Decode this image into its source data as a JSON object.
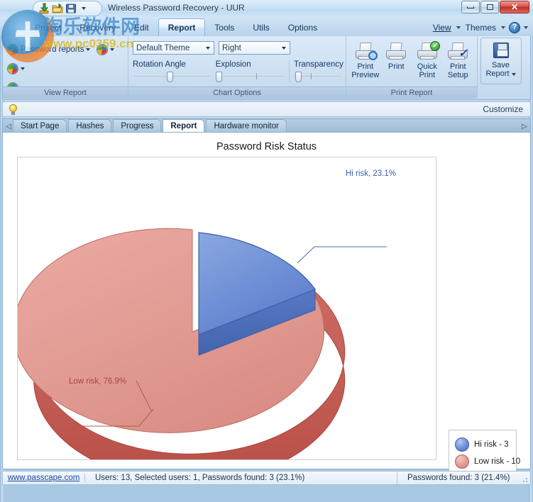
{
  "window": {
    "title": "Wireless Password Recovery - UUR",
    "quick_access": [
      "download-icon",
      "open-folder-icon",
      "save-icon",
      "qat-dropdown-icon"
    ],
    "controls": {
      "minimize": "minimize-icon",
      "maximize": "maximize-icon",
      "close": "✕"
    }
  },
  "menu": {
    "items": [
      "Project",
      "Recovery",
      "Edit",
      "Report",
      "Tools",
      "Utils",
      "Options"
    ],
    "active": "Report",
    "right": {
      "view": "View",
      "themes": "Themes",
      "help": "?"
    }
  },
  "ribbon": {
    "groups": [
      {
        "title": "View Report",
        "rows": [
          {
            "label": "Password reports",
            "icon": "pie-report-icon"
          },
          {
            "label": "",
            "icon": "pie-report-icon"
          },
          {
            "label": "",
            "icon": "pie-report-icon"
          }
        ]
      },
      {
        "title": "Chart Options",
        "theme_combo": "Default Theme",
        "legend_combo": "Right",
        "rotation_label": "Rotation Angle",
        "explosion_label": "Explosion",
        "transparency_label": "Transparency"
      },
      {
        "title": "Print Report",
        "buttons": [
          {
            "line1": "Print",
            "line2": "Preview",
            "icon": "print-preview-icon"
          },
          {
            "line1": "Print",
            "line2": "",
            "icon": "print-icon"
          },
          {
            "line1": "Quick",
            "line2": "Print",
            "icon": "quick-print-icon"
          },
          {
            "line1": "Print",
            "line2": "Setup",
            "icon": "print-setup-icon"
          }
        ]
      },
      {
        "title": "",
        "save": {
          "line1": "Save",
          "line2": "Report",
          "icon": "save-report-icon"
        }
      }
    ]
  },
  "customize_bar": {
    "hint_icon": "lightbulb-icon",
    "label": "Customize"
  },
  "tabs": {
    "items": [
      "Start Page",
      "Hashes",
      "Progress",
      "Report",
      "Hardware monitor"
    ],
    "selected": "Report",
    "scroll_left": "◁",
    "scroll_right": "▷"
  },
  "chart_data": {
    "type": "pie",
    "title": "Password Risk Status",
    "categories": [
      "Hi risk",
      "Low risk"
    ],
    "values": [
      3,
      10
    ],
    "percent_labels": [
      "Hi risk, 23.1%",
      "Low risk, 76.9%"
    ],
    "percents": [
      23.1,
      76.9
    ],
    "colors": [
      "#6B8FD4",
      "#DD8A80"
    ],
    "legend": {
      "position": "right",
      "entries": [
        "Hi risk - 3",
        "Low risk - 10"
      ]
    },
    "three_d": true,
    "start_angle_deg": 0,
    "xlabel": "",
    "ylabel": "",
    "grid": false
  },
  "statusbar": {
    "link": "www.passcape.com",
    "main": "Users: 13,    Selected users: 1,    Passwords found: 3 (23.1%)",
    "right": "Passwords found: 3 (21.4%)"
  },
  "watermark": {
    "cn": "淘乐软件网",
    "url": "www.pc0359.cn"
  }
}
